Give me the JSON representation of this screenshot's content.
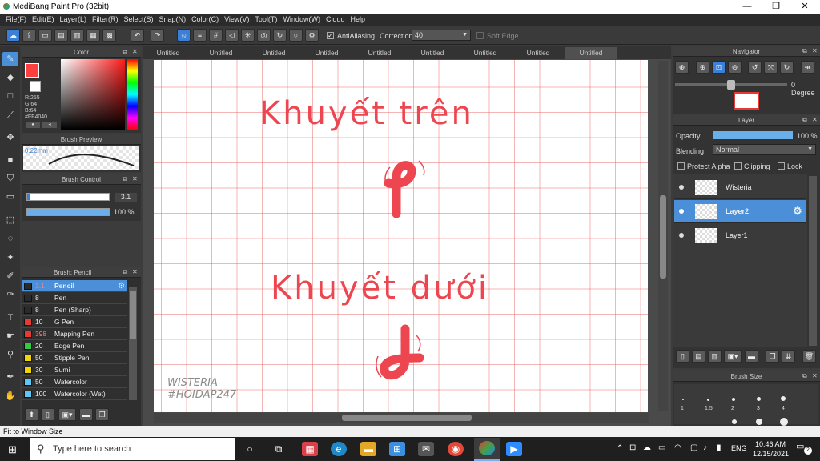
{
  "window": {
    "title": "MediBang Paint Pro (32bit)",
    "minimize": "—",
    "maximize": "❐",
    "close": "✕"
  },
  "menu": [
    "File(F)",
    "Edit(E)",
    "Layer(L)",
    "Filter(R)",
    "Select(S)",
    "Snap(N)",
    "Color(C)",
    "View(V)",
    "Tool(T)",
    "Window(W)",
    "Cloud",
    "Help"
  ],
  "toolbar": {
    "antialiasing_label": "AntiAliasing",
    "correction_label": "Correction",
    "correction_value": "40",
    "soft_edge_label": "Soft Edge"
  },
  "color_panel": {
    "title": "Color",
    "r": "R:255",
    "g": "G:64",
    "b": "B:64",
    "hex": "#FF4040",
    "fg": "#ff4040"
  },
  "brush_preview": {
    "title": "Brush Preview",
    "size": "0.22mm"
  },
  "brush_control": {
    "title": "Brush Control",
    "size": "3.1",
    "opacity": "100 %"
  },
  "brush_list": {
    "title": "Brush: Pencil",
    "items": [
      {
        "size": "3.1",
        "name": "Pencil",
        "color": "#2a2a2a"
      },
      {
        "size": "8",
        "name": "Pen",
        "color": "#2a2a2a"
      },
      {
        "size": "8",
        "name": "Pen (Sharp)",
        "color": "#2a2a2a"
      },
      {
        "size": "10",
        "name": "G Pen",
        "color": "#e53935"
      },
      {
        "size": "398",
        "name": "Mapping Pen",
        "color": "#e53935"
      },
      {
        "size": "20",
        "name": "Edge Pen",
        "color": "#2ecc40"
      },
      {
        "size": "50",
        "name": "Stipple Pen",
        "color": "#f1d600"
      },
      {
        "size": "30",
        "name": "Sumi",
        "color": "#f1d600"
      },
      {
        "size": "50",
        "name": "Watercolor",
        "color": "#5bc8f5"
      },
      {
        "size": "100",
        "name": "Watercolor (Wet)",
        "color": "#5bc8f5"
      }
    ]
  },
  "tabs": [
    "Untitled",
    "Untitled",
    "Untitled",
    "Untitled",
    "Untitled",
    "Untitled",
    "Untitled",
    "Untitled",
    "Untitled"
  ],
  "canvas": {
    "line1": "Khuyết trên",
    "line2": "Khuyết dưới",
    "watermark1": "WISTERIA",
    "watermark2": "#HOIDAP247",
    "ink": "#ee4650"
  },
  "navigator": {
    "title": "Navigator",
    "rotation": "0 Degree"
  },
  "layer_panel": {
    "title": "Layer",
    "opacity_label": "Opacity",
    "opacity_value": "100 %",
    "blending_label": "Blending",
    "blending_value": "Normal",
    "protect_alpha": "Protect Alpha",
    "clipping": "Clipping",
    "lock": "Lock",
    "layers": [
      {
        "name": "Wisteria",
        "selected": false
      },
      {
        "name": "Layer2",
        "selected": true
      },
      {
        "name": "Layer1",
        "selected": false
      }
    ]
  },
  "brush_size": {
    "title": "Brush Size",
    "sizes": [
      "1",
      "1.5",
      "2",
      "3",
      "4"
    ]
  },
  "status": {
    "text": "Fit to Window Size"
  },
  "taskbar": {
    "search_placeholder": "Type here to search",
    "lang": "ENG",
    "time": "10:46 AM",
    "date": "12/15/2021",
    "notif": "2"
  }
}
